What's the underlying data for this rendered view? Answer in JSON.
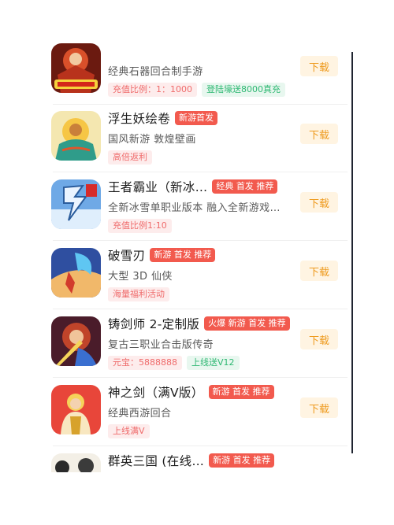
{
  "download_label": "下载",
  "colors": {
    "badge": "#f25a4e",
    "download_bg": "#fff4e2",
    "download_text": "#ee9a1d",
    "tag_red": "#ef6b6b",
    "tag_green": "#2fb873"
  },
  "games": [
    {
      "name": "",
      "badge": "",
      "desc": "经典石器回合制手游",
      "tags": [
        {
          "text": "充值比例：1：1000",
          "color": "red"
        },
        {
          "text": "登陆壕送8000真充",
          "color": "green"
        }
      ],
      "icon": "dragon-warrior-game-icon"
    },
    {
      "name": "浮生妖绘卷",
      "badge": "新游首发",
      "desc": "国风新游 敦煌壁画",
      "tags": [
        {
          "text": "高倍返利",
          "color": "red"
        }
      ],
      "icon": "monkey-king-game-icon"
    },
    {
      "name": "王者霸业（新冰…",
      "badge": "经典 首发 推荐",
      "desc": "全新冰雪单职业版本 融入全新游戏…",
      "tags": [
        {
          "text": "充值比例1:10",
          "color": "red"
        }
      ],
      "icon": "ice-dragon-game-icon"
    },
    {
      "name": "破雪刃",
      "badge": "新游 首发 推荐",
      "desc": "大型 3D 仙侠",
      "tags": [
        {
          "text": "海量福利活动",
          "color": "red"
        }
      ],
      "icon": "dragon-hero-game-icon"
    },
    {
      "name": "铸剑师 2-定制版",
      "badge": "火爆 新游 首发 推荐",
      "desc": "复古三职业合击版传奇",
      "tags": [
        {
          "text": "元宝：5888888",
          "color": "red"
        },
        {
          "text": "上线送V12",
          "color": "green"
        }
      ],
      "icon": "swordsman-game-icon"
    },
    {
      "name": "神之剑（满Ⅴ版）",
      "badge": "新游 首发 推荐",
      "desc": "经典西游回合",
      "tags": [
        {
          "text": "上线满Ⅴ",
          "color": "red"
        }
      ],
      "icon": "tang-monk-game-icon"
    },
    {
      "name": "群英三国 (在线…",
      "badge": "新游 首发 推荐",
      "desc": "",
      "tags": [],
      "icon": "three-kingdoms-game-icon"
    }
  ]
}
